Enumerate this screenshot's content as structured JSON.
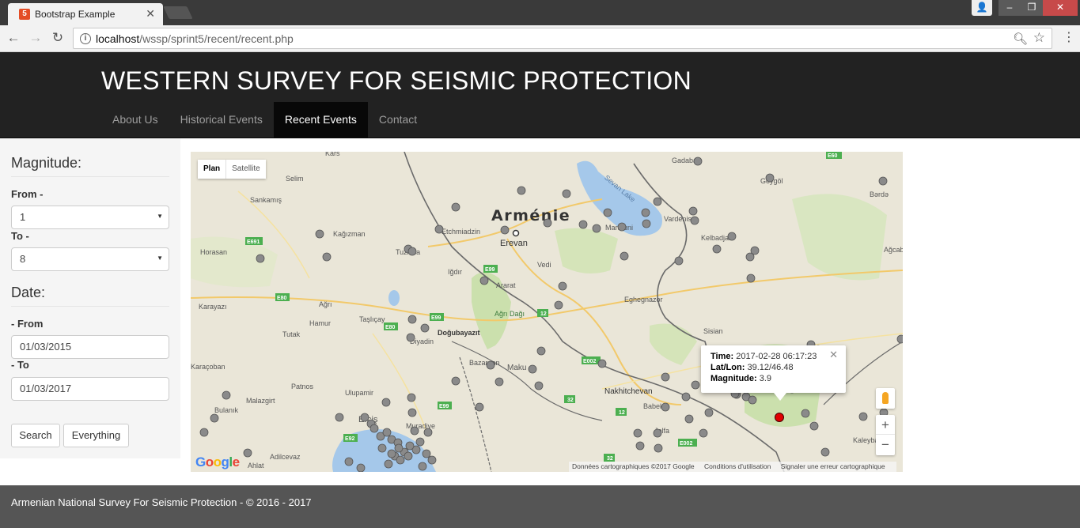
{
  "browser": {
    "tab_title": "Bootstrap Example",
    "url_host": "localhost",
    "url_path": "/wssp/sprint5/recent/recent.php"
  },
  "site": {
    "title": "WESTERN SURVEY FOR SEISMIC PROTECTION",
    "nav": [
      "About Us",
      "Historical Events",
      "Recent Events",
      "Contact"
    ],
    "active_nav": "Recent Events"
  },
  "filters": {
    "magnitude_heading": "Magnitude:",
    "from_label": "From -",
    "from_value": "1",
    "to_label": "To -",
    "to_value": "8",
    "date_heading": "Date:",
    "date_from_label": "- From",
    "date_from_value": "01/03/2015",
    "date_to_label": "- To",
    "date_to_value": "01/03/2017",
    "search_button": "Search",
    "everything_button": "Everything"
  },
  "map": {
    "map_type_options": [
      "Plan",
      "Satellite"
    ],
    "selected_map_type": "Plan",
    "country_label": "Arménie",
    "place_labels": [
      "Kars",
      "Selim",
      "Sankamış",
      "Kağızman",
      "Horasan",
      "Karayazı",
      "Ağrı",
      "Hamur",
      "Taşlıçay",
      "Tutak",
      "Diyadin",
      "Doğubayazıt",
      "Karaçoban",
      "Patnos",
      "Malazgirt",
      "Bulanık",
      "Ulupamir",
      "Erciş",
      "Muradiye",
      "Adilcevaz",
      "Ahlat",
      "Iğdır",
      "Tuzluca",
      "Etchmiadzin",
      "Erevan",
      "Ararat",
      "Vedi",
      "Ağrı Dağı",
      "Bazargan",
      "Maku",
      "Nakhitchevan",
      "Babek",
      "Jolfa",
      "Sevan Lake",
      "Martouni",
      "Vardenis",
      "Kelbadjar",
      "Eghegnazor",
      "Sisian",
      "Gadabay",
      "Göygöl",
      "Bərdə",
      "Ağcab",
      "Kaleybar"
    ],
    "road_labels": [
      "E691",
      "E80",
      "E99",
      "E002",
      "E60",
      "E92",
      "12",
      "32"
    ],
    "info_window": {
      "time_label": "Time:",
      "time_value": "2017-02-28 06:17:23",
      "latlon_label": "Lat/Lon:",
      "latlon_value": "39.12/46.48",
      "magnitude_label": "Magnitude:",
      "magnitude_value": "3.9"
    },
    "attribution": [
      "Données cartographiques ©2017 Google",
      "Conditions d'utilisation",
      "Signaler une erreur cartographique"
    ],
    "logo": "Google",
    "colors": {
      "land": "#eae6d8",
      "water": "#a5c8ea",
      "park": "#c8dfa8",
      "border": "#6b6b6b",
      "marker": "#8a8a8a",
      "selected_marker": "#e00000"
    }
  },
  "footer": {
    "text": "Armenian National Survey For Seismic Protection - © 2016 - 2017"
  }
}
